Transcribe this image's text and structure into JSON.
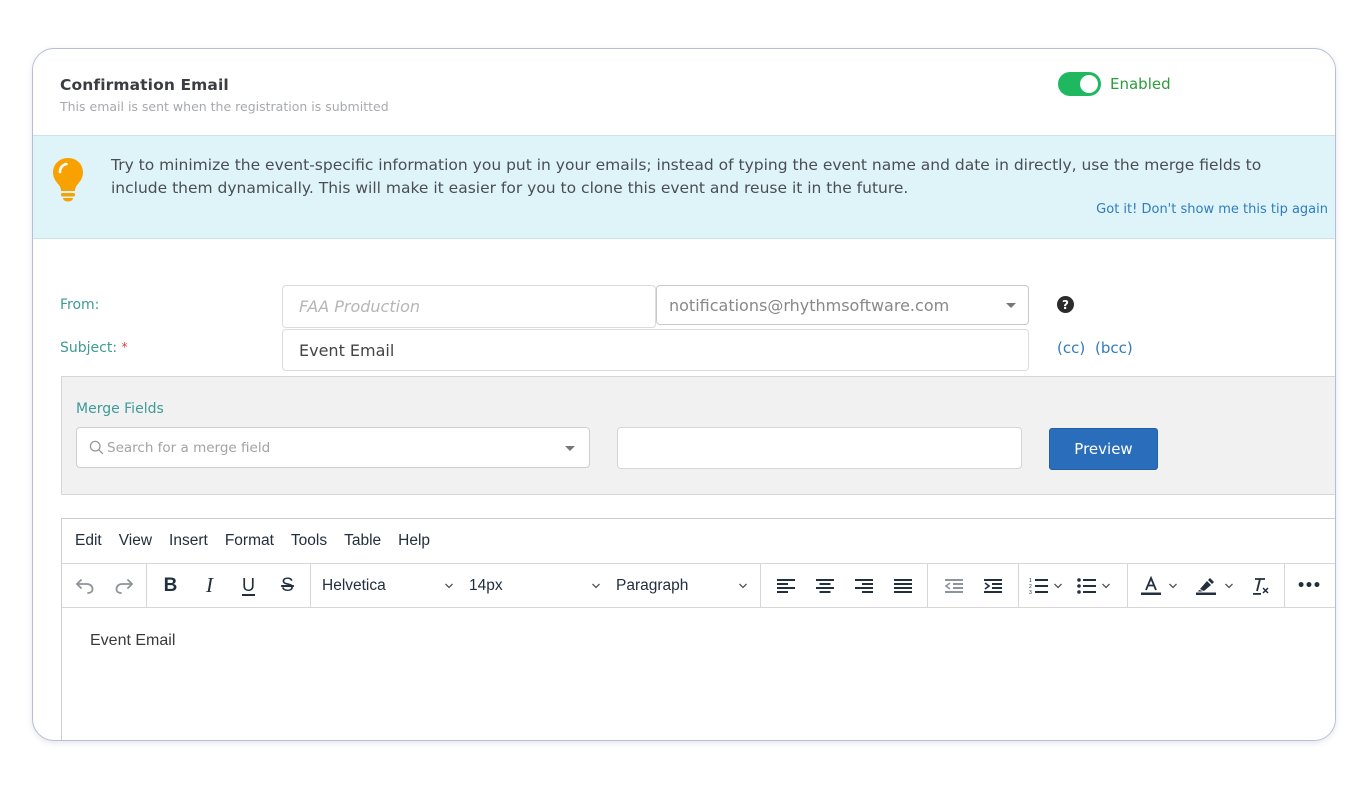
{
  "card": {
    "title": "Confirmation Email",
    "subtitle": "This email is sent when the registration is submitted",
    "toggle": {
      "state": "on",
      "label": "Enabled",
      "color": "#1fb860"
    }
  },
  "tip": {
    "icon": "lightbulb-icon",
    "text": "Try to minimize the event-specific information you put in your emails; instead of typing the event name and date in directly, use the merge fields to include them dynamically. This will make it easier for you to clone this event and reuse it in the future.",
    "dismiss_label": "Got it! Don't show me this tip again"
  },
  "form": {
    "from_label": "From:",
    "from_name_placeholder": "FAA Production",
    "from_email_selected": "notifications@rhythmsoftware.com",
    "help_icon": "?",
    "subject_label": "Subject:",
    "required_marker": "*",
    "subject_value": "Event Email",
    "cc_label": "(cc)",
    "bcc_label": "(bcc)"
  },
  "merge": {
    "label": "Merge Fields",
    "search_placeholder": "Search for a merge field",
    "text_value": "",
    "preview_label": "Preview"
  },
  "editor": {
    "menu": [
      "Edit",
      "View",
      "Insert",
      "Format",
      "Tools",
      "Table",
      "Help"
    ],
    "font_family": "Helvetica",
    "font_size": "14px",
    "block_format": "Paragraph",
    "more_icon": "•••",
    "body_text": "Event Email"
  },
  "colors": {
    "accent_teal": "#3e9a96",
    "link_blue": "#2f7cc1",
    "primary_button": "#2a6ebb",
    "tip_background": "#dff4f9",
    "bulb": "#f7a200"
  }
}
